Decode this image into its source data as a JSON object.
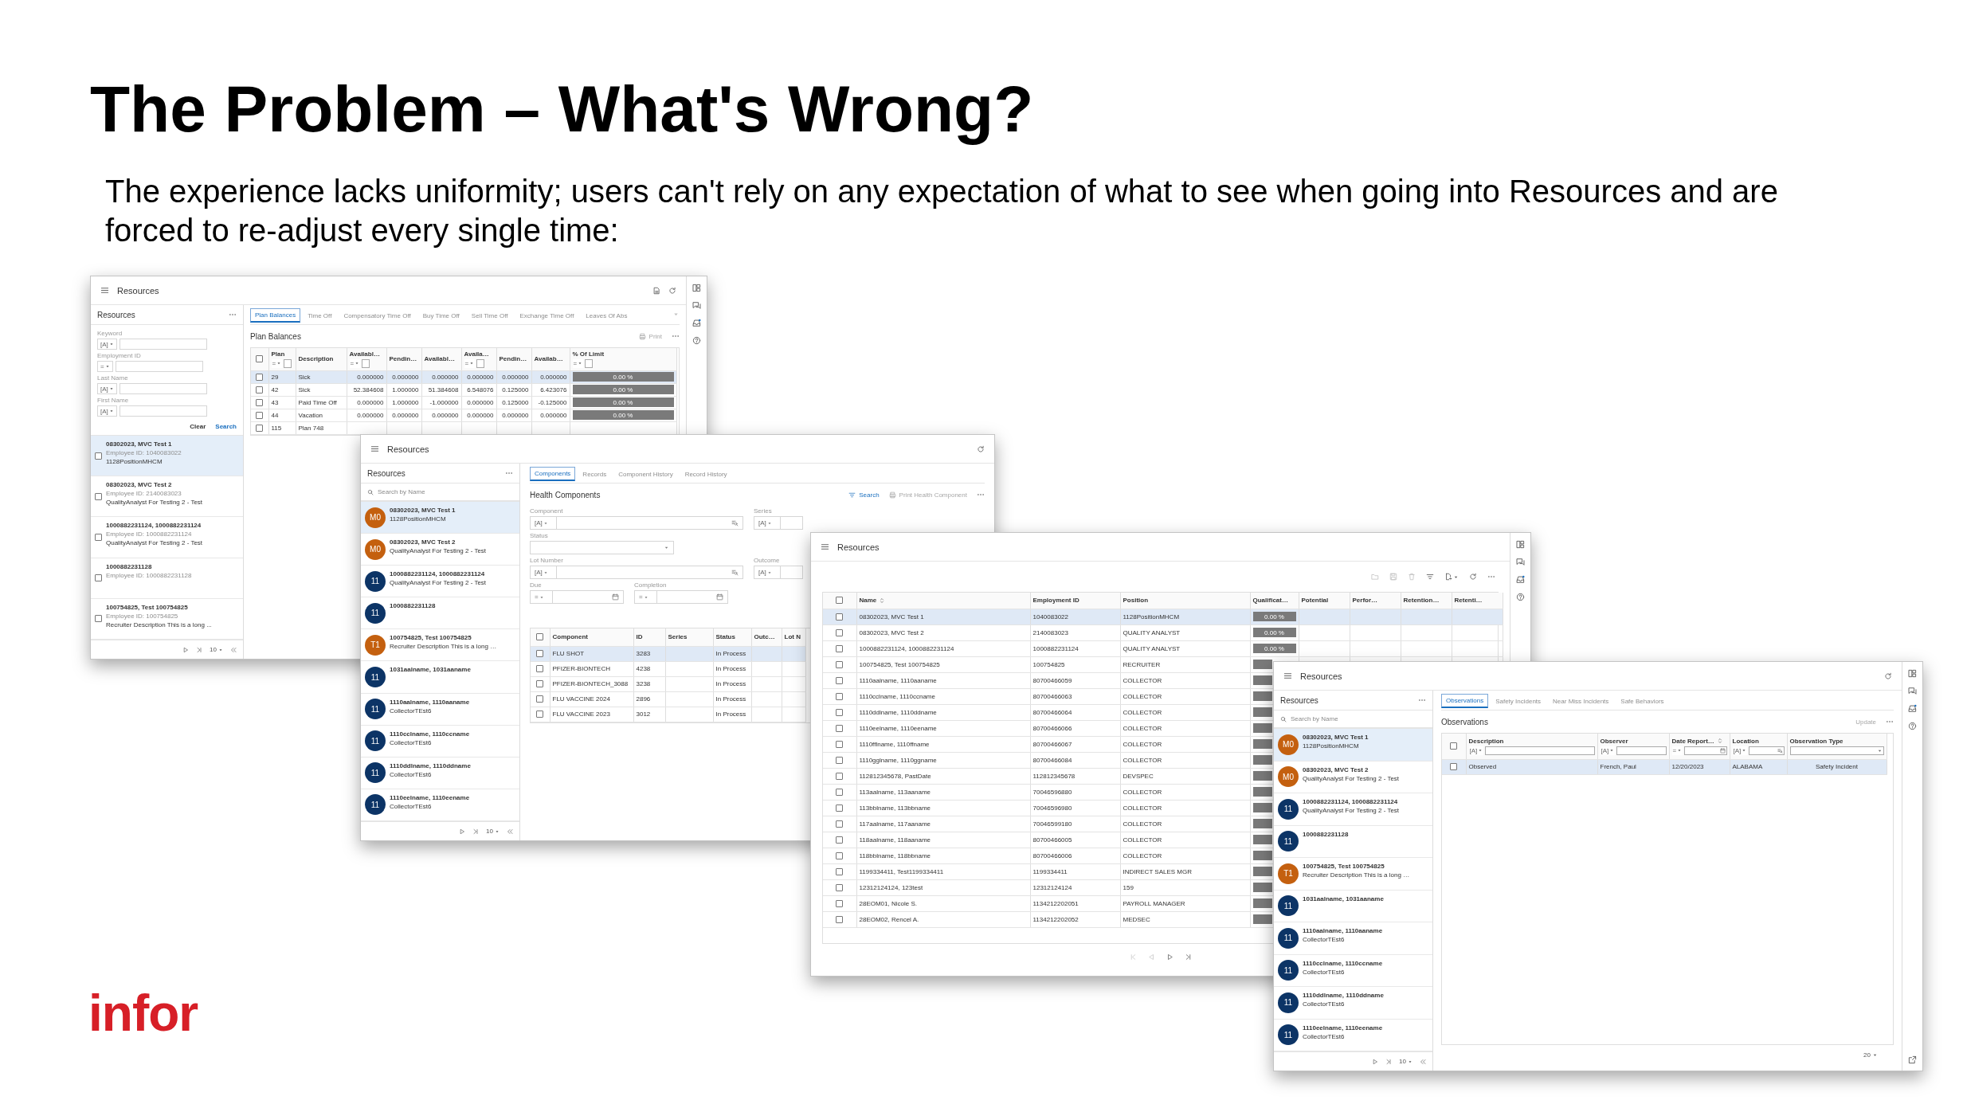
{
  "slide": {
    "title": "The Problem – What's Wrong?",
    "subtitle": "The experience lacks uniformity; users can't rely on any expectation of what to see when going into Resources and are forced to re-adjust every single time:",
    "logo": "infor"
  },
  "windows": [
    {
      "title": "Resources",
      "side_rail": true,
      "sidebar": {
        "kind": "filter",
        "title": "Resources",
        "filters": [
          {
            "label": "Keyword",
            "operator": "[A]"
          },
          {
            "label": "Employment ID",
            "operator": "="
          },
          {
            "label": "Last Name",
            "operator": "[A]"
          },
          {
            "label": "First Name",
            "operator": "[A]"
          }
        ],
        "buttons": [
          {
            "label": "Clear",
            "primary": false
          },
          {
            "label": "Search",
            "primary": true
          }
        ],
        "items": [
          {
            "title": "08302023, MVC Test 1",
            "lines": [
              "Employee ID: 1040083022",
              "1128PositionMHCM"
            ],
            "checked": false,
            "selected": true
          },
          {
            "title": "08302023, MVC Test 2",
            "lines": [
              "Employee ID: 2140083023",
              "QualityAnalyst For Testing 2 - Test"
            ],
            "checked": false,
            "selected": false
          },
          {
            "title": "1000882231124, 1000882231124",
            "lines": [
              "Employee ID: 1000882231124",
              "QualityAnalyst For Testing 2 - Test"
            ],
            "checked": false,
            "selected": false
          },
          {
            "title": "1000882231128",
            "lines": [
              "Employee ID: 1000882231128"
            ],
            "checked": false,
            "selected": false
          },
          {
            "title": "100754825, Test 100754825",
            "lines": [
              "Employee ID: 100754825",
              "Recruiter Description This is a long ..."
            ],
            "checked": false,
            "selected": false
          }
        ],
        "page_size": "10"
      },
      "tabs": [
        {
          "label": "Plan Balances",
          "selected": true
        },
        {
          "label": "Time Off",
          "selected": false
        },
        {
          "label": "Compensatory Time Off",
          "selected": false
        },
        {
          "label": "Buy Time Off",
          "selected": false
        },
        {
          "label": "Sell Time Off",
          "selected": false
        },
        {
          "label": "Exchange Time Off",
          "selected": false
        },
        {
          "label": "Leaves Of Abs",
          "selected": false
        }
      ],
      "heading": "Plan Balances",
      "actions": [
        {
          "label": "Print",
          "kind": "print",
          "disabled": true
        }
      ],
      "table": {
        "select_all": false,
        "columns": [
          {
            "label": "Plan",
            "filter": {
              "kind": "text",
              "operator": "="
            }
          },
          {
            "label": "Description"
          },
          {
            "label": "Availabl…",
            "filter": {
              "kind": "text",
              "operator": "="
            }
          },
          {
            "label": "Pendin…"
          },
          {
            "label": "Availabl…"
          },
          {
            "label": "Availa…",
            "filter": {
              "kind": "text",
              "operator": "="
            }
          },
          {
            "label": "Pendin…"
          },
          {
            "label": "Availab…"
          },
          {
            "label": "% Of Limit",
            "filter": {
              "kind": "text",
              "operator": "="
            }
          }
        ],
        "rows": [
          {
            "cells": [
              "29",
              "Sick",
              "0.000000",
              "0.000000",
              "0.000000",
              "0.000000",
              "0.000000",
              "0.000000",
              {
                "level": 0,
                "label": "0.00 %"
              }
            ],
            "checked": false,
            "selected": true
          },
          {
            "cells": [
              "42",
              "Sick",
              "52.384608",
              "1.000000",
              "51.384608",
              "6.548076",
              "0.125000",
              "6.423076",
              {
                "level": 0,
                "label": "0.00 %"
              }
            ],
            "checked": false,
            "selected": false
          },
          {
            "cells": [
              "43",
              "Paid Time Off",
              "0.000000",
              "1.000000",
              "-1.000000",
              "0.000000",
              "0.125000",
              "-0.125000",
              {
                "level": 0,
                "label": "0.00 %"
              }
            ],
            "checked": false,
            "selected": false
          },
          {
            "cells": [
              "44",
              "Vacation",
              "0.000000",
              "0.000000",
              "0.000000",
              "0.000000",
              "0.000000",
              "0.000000",
              {
                "level": 0,
                "label": "0.00 %"
              }
            ],
            "checked": false,
            "selected": false
          },
          {
            "cells": [
              "115",
              "Plan 748"
            ],
            "checked": false,
            "selected": false
          }
        ]
      }
    },
    {
      "title": "Resources",
      "side_rail": false,
      "sidebar": {
        "kind": "avatars",
        "title": "Resources",
        "placeholder": "Search by Name",
        "items": [
          {
            "initials": "M0",
            "color": "#c4600f",
            "title": "08302023, MVC Test 1",
            "subtitle": "1128PositionMHCM",
            "selected": true
          },
          {
            "initials": "M0",
            "color": "#c4600f",
            "title": "08302023, MVC Test 2",
            "subtitle": "QualityAnalyst For Testing 2 - Test",
            "selected": false
          },
          {
            "initials": "11",
            "color": "#0c3466",
            "title": "1000882231124, 1000882231124",
            "subtitle": "QualityAnalyst For Testing 2 - Test",
            "selected": false
          },
          {
            "initials": "11",
            "color": "#0c3466",
            "title": "1000882231128",
            "selected": false
          },
          {
            "initials": "T1",
            "color": "#c4600f",
            "title": "100754825, Test 100754825",
            "subtitle": "Recruiter Description This is a long …",
            "selected": false
          },
          {
            "initials": "11",
            "color": "#0c3466",
            "title": "1031aalname, 1031aaname",
            "selected": false
          },
          {
            "initials": "11",
            "color": "#0c3466",
            "title": "1110aalname, 1110aaname",
            "subtitle": "CollectorTEst6",
            "selected": false
          },
          {
            "initials": "11",
            "color": "#0c3466",
            "title": "1110cclname, 1110ccname",
            "subtitle": "CollectorTEst6",
            "selected": false
          },
          {
            "initials": "11",
            "color": "#0c3466",
            "title": "1110ddlname, 1110ddname",
            "subtitle": "CollectorTEst6",
            "selected": false
          },
          {
            "initials": "11",
            "color": "#0c3466",
            "title": "1110eelname, 1110eename",
            "subtitle": "CollectorTEst6",
            "selected": false
          }
        ],
        "page_size": "10"
      },
      "tabs": [
        {
          "label": "Components",
          "selected": true
        },
        {
          "label": "Records",
          "selected": false
        },
        {
          "label": "Component History",
          "selected": false
        },
        {
          "label": "Record History",
          "selected": false
        }
      ],
      "heading": "Health Components",
      "actions": [
        {
          "label": "Search",
          "kind": "filter",
          "disabled": false
        },
        {
          "label": "Print Health Component",
          "kind": "print",
          "disabled": true
        }
      ],
      "form": [
        {
          "label": "Component",
          "kind": "lookup",
          "operator": "[A]"
        },
        {
          "label": "Series",
          "kind": "text",
          "operator": "[A]"
        },
        {
          "label": "Status",
          "kind": "select"
        },
        {
          "label": "Lot Number",
          "kind": "lookup",
          "operator": "[A]"
        },
        {
          "label": "Outcome",
          "kind": "text",
          "operator": "[A]"
        },
        {
          "label": "Due",
          "kind": "date",
          "operator": "="
        },
        {
          "label": "Completion",
          "kind": "date",
          "operator": "="
        }
      ],
      "table": {
        "select_all": false,
        "columns": [
          {
            "label": "Component"
          },
          {
            "label": "ID"
          },
          {
            "label": "Series"
          },
          {
            "label": "Status"
          },
          {
            "label": "Outc…"
          },
          {
            "label": "Lot N"
          }
        ],
        "rows": [
          {
            "cells": [
              "FLU SHOT",
              "3283",
              "",
              "In Process"
            ],
            "checked": false,
            "selected": true
          },
          {
            "cells": [
              "PFIZER-BIONTECH",
              "4238",
              "",
              "In Process"
            ],
            "checked": false,
            "selected": false
          },
          {
            "cells": [
              "PFIZER-BIONTECH_3088",
              "3238",
              "",
              "In Process"
            ],
            "checked": false,
            "selected": false
          },
          {
            "cells": [
              "FLU VACCINE 2024",
              "2896",
              "",
              "In Process"
            ],
            "checked": false,
            "selected": false
          },
          {
            "cells": [
              "FLU VACCINE 2023",
              "3012",
              "",
              "In Process"
            ],
            "checked": false,
            "selected": false
          }
        ]
      }
    },
    {
      "title": "Resources",
      "side_rail": true,
      "table": {
        "select_all": false,
        "columns": [
          {
            "label": "Name",
            "sortable": true
          },
          {
            "label": "Employment ID",
            "sortable": false
          },
          {
            "label": "Position",
            "sortable": false
          },
          {
            "label": "Qualificat…",
            "sortable": false
          },
          {
            "label": "Potential",
            "sortable": false
          },
          {
            "label": "Perfor…",
            "sortable": false
          },
          {
            "label": "Retention…",
            "sortable": false
          },
          {
            "label": "Retenti…",
            "sortable": false
          }
        ],
        "rows": [
          {
            "cells": [
              "08302023, MVC Test 1",
              "1040083022",
              "1128PositionMHCM",
              {
                "level": 0,
                "label": "0.00 %"
              }
            ],
            "checked": false,
            "selected": true
          },
          {
            "cells": [
              "08302023, MVC Test 2",
              "2140083023",
              "QUALITY ANALYST",
              {
                "level": 0,
                "label": "0.00 %"
              }
            ],
            "checked": false,
            "selected": false
          },
          {
            "cells": [
              "1000882231124, 1000882231124",
              "1000882231124",
              "QUALITY ANALYST",
              {
                "level": 0,
                "label": "0.00 %"
              }
            ],
            "checked": false,
            "selected": false
          },
          {
            "cells": [
              "100754825, Test 100754825",
              "100754825",
              "RECRUITER",
              {
                "level": 0
              }
            ],
            "checked": false,
            "selected": false
          },
          {
            "cells": [
              "1110aalname, 1110aaname",
              "80700466059",
              "COLLECTOR",
              {
                "level": 0
              }
            ],
            "checked": false,
            "selected": false
          },
          {
            "cells": [
              "1110cclname, 1110ccname",
              "80700466063",
              "COLLECTOR",
              {
                "level": 0
              }
            ],
            "checked": false,
            "selected": false
          },
          {
            "cells": [
              "1110ddlname, 1110ddname",
              "80700466064",
              "COLLECTOR",
              {
                "level": 0
              }
            ],
            "checked": false,
            "selected": false
          },
          {
            "cells": [
              "1110eelname, 1110eename",
              "80700466066",
              "COLLECTOR",
              {
                "level": 0
              }
            ],
            "checked": false,
            "selected": false
          },
          {
            "cells": [
              "1110fflname, 1110ffname",
              "80700466067",
              "COLLECTOR",
              {
                "level": 0
              }
            ],
            "checked": false,
            "selected": false
          },
          {
            "cells": [
              "1110gglname, 1110ggname",
              "80700466084",
              "COLLECTOR",
              {
                "level": 0
              }
            ],
            "checked": false,
            "selected": false
          },
          {
            "cells": [
              "112812345678, PastDate",
              "112812345678",
              "DEVSPEC",
              {
                "level": 0
              }
            ],
            "checked": false,
            "selected": false
          },
          {
            "cells": [
              "113aalname, 113aaname",
              "70046596880",
              "COLLECTOR",
              {
                "level": 0
              }
            ],
            "checked": false,
            "selected": false
          },
          {
            "cells": [
              "113bblname, 113bbname",
              "70046596980",
              "COLLECTOR",
              {
                "level": 0
              }
            ],
            "checked": false,
            "selected": false
          },
          {
            "cells": [
              "117aalname, 117aaname",
              "70046599180",
              "COLLECTOR",
              {
                "level": 0
              }
            ],
            "checked": false,
            "selected": false
          },
          {
            "cells": [
              "118aalname, 118aaname",
              "80700466005",
              "COLLECTOR",
              {
                "level": 0
              }
            ],
            "checked": false,
            "selected": false
          },
          {
            "cells": [
              "118bblname, 118bbname",
              "80700466006",
              "COLLECTOR",
              {
                "level": 0
              }
            ],
            "checked": false,
            "selected": false
          },
          {
            "cells": [
              "1199334411, Test1199334411",
              "1199334411",
              "INDIRECT SALES MGR",
              {
                "level": 0
              }
            ],
            "checked": false,
            "selected": false
          },
          {
            "cells": [
              "12312124124, 123test",
              "12312124124",
              "159",
              {
                "level": 0
              }
            ],
            "checked": false,
            "selected": false
          },
          {
            "cells": [
              "28EOM01, Nicole S.",
              "1134212202051",
              "PAYROLL MANAGER",
              {
                "level": 0
              }
            ],
            "checked": false,
            "selected": false
          },
          {
            "cells": [
              "28EOM02, Rencel A.",
              "1134212202052",
              "MEDSEC",
              {
                "level": 0
              }
            ],
            "checked": false,
            "selected": false
          }
        ]
      }
    },
    {
      "title": "Resources",
      "side_rail": true,
      "sidebar": {
        "kind": "avatars",
        "title": "Resources",
        "placeholder": "Search by Name",
        "items": [
          {
            "initials": "M0",
            "color": "#c4600f",
            "title": "08302023, MVC Test 1",
            "subtitle": "1128PositionMHCM",
            "selected": true
          },
          {
            "initials": "M0",
            "color": "#c4600f",
            "title": "08302023, MVC Test 2",
            "subtitle": "QualityAnalyst For Testing 2 - Test",
            "selected": false
          },
          {
            "initials": "11",
            "color": "#0c3466",
            "title": "1000882231124, 1000882231124",
            "subtitle": "QualityAnalyst For Testing 2 - Test",
            "selected": false
          },
          {
            "initials": "11",
            "color": "#0c3466",
            "title": "1000882231128",
            "selected": false
          },
          {
            "initials": "T1",
            "color": "#c4600f",
            "title": "100754825, Test 100754825",
            "subtitle": "Recruiter Description This is a long …",
            "selected": false
          },
          {
            "initials": "11",
            "color": "#0c3466",
            "title": "1031aalname, 1031aaname",
            "selected": false
          },
          {
            "initials": "11",
            "color": "#0c3466",
            "title": "1110aalname, 1110aaname",
            "subtitle": "CollectorTEst6",
            "selected": false
          },
          {
            "initials": "11",
            "color": "#0c3466",
            "title": "1110cclname, 1110ccname",
            "subtitle": "CollectorTEst6",
            "selected": false
          },
          {
            "initials": "11",
            "color": "#0c3466",
            "title": "1110ddlname, 1110ddname",
            "subtitle": "CollectorTEst6",
            "selected": false
          },
          {
            "initials": "11",
            "color": "#0c3466",
            "title": "1110eelname, 1110eename",
            "subtitle": "CollectorTEst6",
            "selected": false
          }
        ],
        "page_size": "10"
      },
      "tabs": [
        {
          "label": "Observations",
          "selected": true
        },
        {
          "label": "Safety Incidents",
          "selected": false
        },
        {
          "label": "Near Miss Incidents",
          "selected": false
        },
        {
          "label": "Safe Behaviors",
          "selected": false
        }
      ],
      "heading": "Observations",
      "actions": [
        {
          "label": "Update",
          "kind": "plain",
          "disabled": true
        }
      ],
      "table": {
        "select_all": false,
        "page_size": "20",
        "columns": [
          {
            "label": "Description",
            "filter": {
              "kind": "text",
              "operator": "[A]"
            },
            "sortable": false
          },
          {
            "label": "Observer",
            "filter": {
              "kind": "text",
              "operator": "[A]"
            },
            "sortable": false
          },
          {
            "label": "Date Report…",
            "filter": {
              "kind": "date",
              "operator": "="
            },
            "sortable": true
          },
          {
            "label": "Location",
            "filter": {
              "kind": "lookup",
              "operator": "[A]"
            },
            "sortable": false
          },
          {
            "label": "Observation Type",
            "filter": {
              "kind": "select"
            },
            "sortable": false
          }
        ],
        "rows": [
          {
            "cells": [
              "Observed",
              "French, Paul",
              "12/20/2023",
              "ALABAMA",
              "Safety Incident"
            ],
            "checked": false,
            "selected": true
          }
        ]
      }
    }
  ]
}
